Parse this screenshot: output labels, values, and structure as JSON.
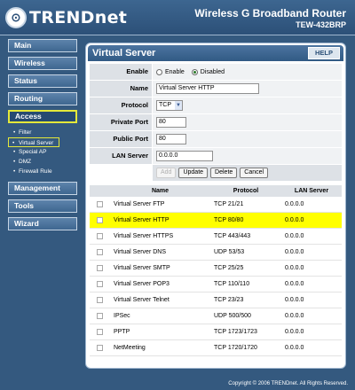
{
  "header": {
    "logo_text": "TRENDnet",
    "logo_mark": "⊙",
    "product_title": "Wireless G Broadband Router",
    "model": "TEW-432BRP"
  },
  "sidebar": {
    "items": [
      {
        "label": "Main"
      },
      {
        "label": "Wireless"
      },
      {
        "label": "Status"
      },
      {
        "label": "Routing"
      },
      {
        "label": "Access"
      },
      {
        "label": "Management"
      },
      {
        "label": "Tools"
      },
      {
        "label": "Wizard"
      }
    ],
    "access_sub": [
      {
        "label": "Filter"
      },
      {
        "label": "Virtual Server"
      },
      {
        "label": "Special AP"
      },
      {
        "label": "DMZ"
      },
      {
        "label": "Firewall Rule"
      }
    ]
  },
  "panel": {
    "title": "Virtual Server",
    "help": "HELP"
  },
  "form": {
    "enable_label": "Enable",
    "enable_opt": "Enable",
    "disable_opt": "Disabled",
    "name_label": "Name",
    "name_value": "Virtual Server HTTP",
    "protocol_label": "Protocol",
    "protocol_value": "TCP",
    "private_port_label": "Private Port",
    "private_port_value": "80",
    "public_port_label": "Public Port",
    "public_port_value": "80",
    "lan_server_label": "LAN Server",
    "lan_server_value": "0.0.0.0",
    "add": "Add",
    "update": "Update",
    "delete": "Delete",
    "cancel": "Cancel"
  },
  "table": {
    "headers": [
      "Name",
      "Protocol",
      "LAN Server"
    ],
    "rows": [
      {
        "name": "Virtual Server FTP",
        "protocol": "TCP 21/21",
        "lan": "0.0.0.0"
      },
      {
        "name": "Virtual Server HTTP",
        "protocol": "TCP 80/80",
        "lan": "0.0.0.0"
      },
      {
        "name": "Virtual Server HTTPS",
        "protocol": "TCP 443/443",
        "lan": "0.0.0.0"
      },
      {
        "name": "Virtual Server DNS",
        "protocol": "UDP 53/53",
        "lan": "0.0.0.0"
      },
      {
        "name": "Virtual Server SMTP",
        "protocol": "TCP 25/25",
        "lan": "0.0.0.0"
      },
      {
        "name": "Virtual Server POP3",
        "protocol": "TCP 110/110",
        "lan": "0.0.0.0"
      },
      {
        "name": "Virtual Server Telnet",
        "protocol": "TCP 23/23",
        "lan": "0.0.0.0"
      },
      {
        "name": "IPSec",
        "protocol": "UDP 500/500",
        "lan": "0.0.0.0"
      },
      {
        "name": "PPTP",
        "protocol": "TCP 1723/1723",
        "lan": "0.0.0.0"
      },
      {
        "name": "NetMeeting",
        "protocol": "TCP 1720/1720",
        "lan": "0.0.0.0"
      }
    ]
  },
  "footer": "Copyright © 2006 TRENDnet. All Rights Reserved.",
  "colors": {
    "background": "#34597f",
    "highlight_row": "#ffff00",
    "active_border": "#e4e83a"
  }
}
